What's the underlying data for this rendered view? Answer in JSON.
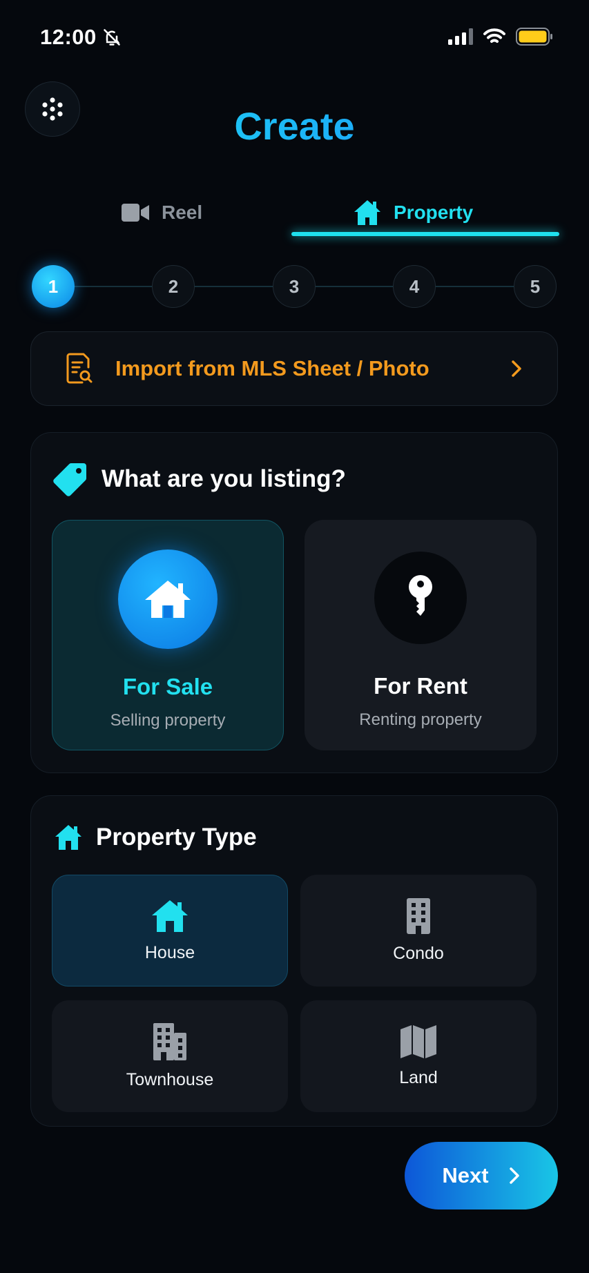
{
  "status_bar": {
    "time": "12:00",
    "icons": [
      "bell-off-icon",
      "signal-icon",
      "wifi-icon",
      "battery-icon"
    ]
  },
  "header": {
    "title": "Create",
    "menu_icon": "grid-dots-icon"
  },
  "tabs": [
    {
      "label": "Reel",
      "icon": "video-icon",
      "active": false
    },
    {
      "label": "Property",
      "icon": "home-icon",
      "active": true
    }
  ],
  "stepper": {
    "steps": [
      "1",
      "2",
      "3",
      "4",
      "5"
    ],
    "current": 1
  },
  "import": {
    "label": "Import from MLS Sheet / Photo",
    "icon": "document-search-icon"
  },
  "listing": {
    "heading": "What are you listing?",
    "options": [
      {
        "title": "For Sale",
        "subtitle": "Selling property",
        "icon": "home-icon",
        "selected": true
      },
      {
        "title": "For Rent",
        "subtitle": "Renting property",
        "icon": "key-icon",
        "selected": false
      }
    ]
  },
  "property_type": {
    "heading": "Property Type",
    "options": [
      {
        "label": "House",
        "icon": "home-icon",
        "selected": true
      },
      {
        "label": "Condo",
        "icon": "building-icon",
        "selected": false
      },
      {
        "label": "Townhouse",
        "icon": "townhouse-icon",
        "selected": false
      },
      {
        "label": "Land",
        "icon": "map-icon",
        "selected": false
      }
    ]
  },
  "footer": {
    "next_label": "Next"
  },
  "colors": {
    "accent_cyan": "#1fe0ee",
    "accent_blue": "#0b79e3",
    "import_orange": "#f39a1e",
    "background": "#05080d"
  }
}
